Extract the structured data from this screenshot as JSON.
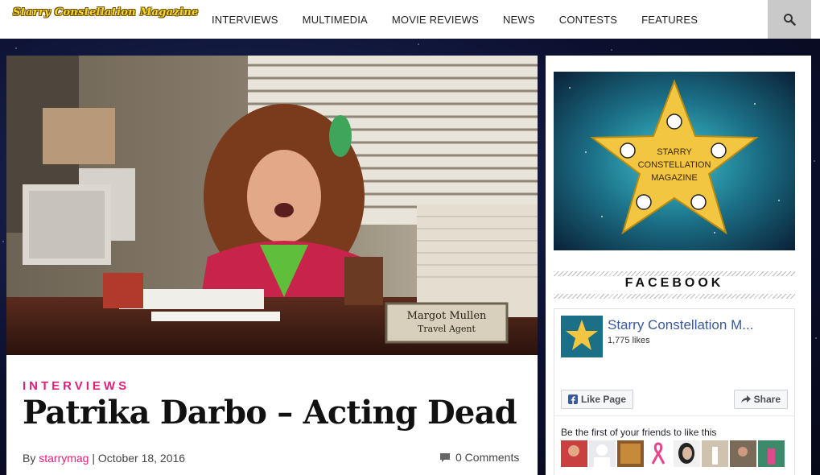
{
  "site": {
    "logo": "Starry Constellation Magazine"
  },
  "nav": {
    "items": [
      {
        "label": "INTERVIEWS"
      },
      {
        "label": "MULTIMEDIA"
      },
      {
        "label": "MOVIE REVIEWS"
      },
      {
        "label": "NEWS"
      },
      {
        "label": "CONTESTS"
      },
      {
        "label": "FEATURES"
      }
    ],
    "search_icon": "search-icon"
  },
  "article": {
    "category": "INTERVIEWS",
    "title": "Patrika Darbo – Acting Dead",
    "by_prefix": "By",
    "author": "starrymag",
    "separator": "|",
    "date": "October 18, 2016",
    "comments": "0 Comments",
    "hero_nameplate_line1": "Margot Mullen",
    "hero_nameplate_line2": "Travel Agent"
  },
  "sidebar": {
    "promo_text_line1": "STARRY",
    "promo_text_line2": "CONSTELLATION",
    "promo_text_line3": "MAGAZINE",
    "facebook_heading": "FACEBOOK",
    "fb": {
      "page_name": "Starry Constellation M...",
      "likes": "1,775 likes",
      "like_button": "Like Page",
      "share_button": "Share",
      "friends_text": "Be the first of your friends to like this"
    }
  },
  "colors": {
    "accent": "#e0207a",
    "fb_blue": "#3b5998",
    "logo_yellow": "#f3d826"
  }
}
